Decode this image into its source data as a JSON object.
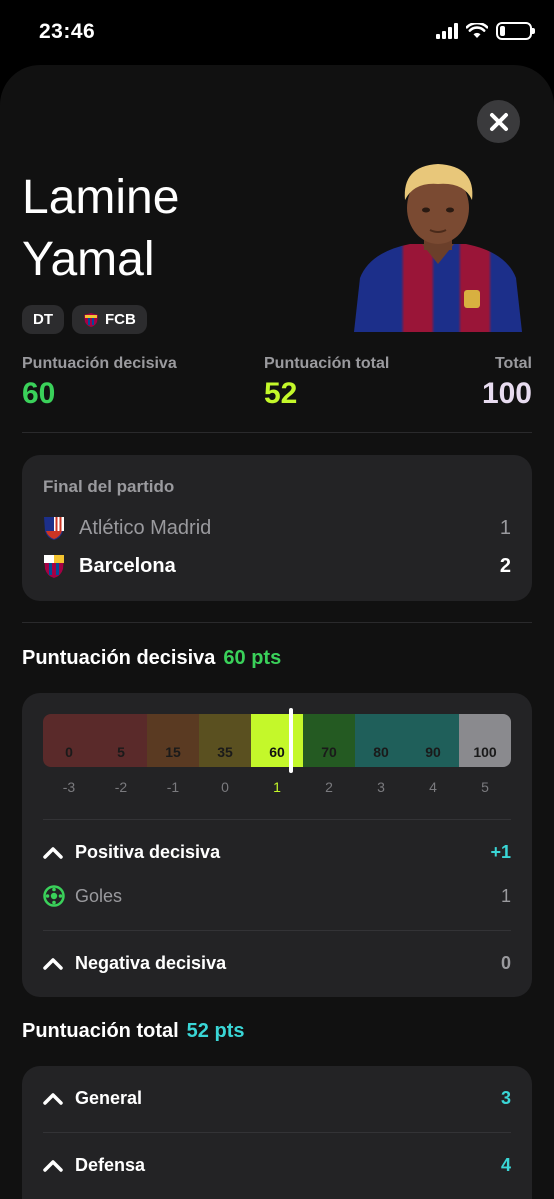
{
  "status_bar": {
    "time": "23:46"
  },
  "player": {
    "first_name": "Lamine",
    "last_name": "Yamal",
    "position": "DT",
    "club": "FCB"
  },
  "scores": {
    "decisive_label": "Puntuación decisiva",
    "decisive_value": "60",
    "total_label": "Puntuación total",
    "total_value": "52",
    "overall_label": "Total",
    "overall_value": "100"
  },
  "match": {
    "title": "Final del partido",
    "home_team": "Atlético Madrid",
    "home_score": "1",
    "away_team": "Barcelona",
    "away_score": "2"
  },
  "decisive_section": {
    "title": "Puntuación decisiva",
    "pts": "60 pts",
    "scale_values": [
      "0",
      "5",
      "15",
      "35",
      "60",
      "70",
      "80",
      "90",
      "100"
    ],
    "scale_points": [
      "-3",
      "-2",
      "-1",
      "0",
      "1",
      "2",
      "3",
      "4",
      "5"
    ],
    "active_index": 4,
    "positive_label": "Positiva decisiva",
    "positive_value": "+1",
    "goals_label": "Goles",
    "goals_value": "1",
    "negative_label": "Negativa decisiva",
    "negative_value": "0"
  },
  "total_section": {
    "title": "Puntuación total",
    "pts": "52 pts",
    "general_label": "General",
    "general_value": "3",
    "defense_label": "Defensa",
    "defense_value": "4"
  },
  "colors": {
    "green": "#3ad15a",
    "lime": "#c4f82a",
    "cyan": "#3ad6d6",
    "scale": [
      "#5a2a2a",
      "#5a2a2a",
      "#5a3a22",
      "#5a5020",
      "#c4f82a",
      "#245a22",
      "#1f5f5a",
      "#1f5f5a",
      "#8a8a8e"
    ]
  }
}
